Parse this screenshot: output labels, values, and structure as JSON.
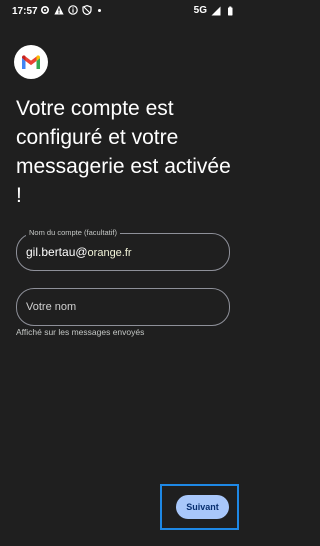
{
  "status_bar": {
    "time": "17:57",
    "left_icons": [
      "gear-icon",
      "warning-icon",
      "info-icon",
      "shield-icon"
    ],
    "network": "5G",
    "right_icons": [
      "signal-icon",
      "battery-icon"
    ]
  },
  "app": {
    "logo": "gmail-logo"
  },
  "headline": "Votre compte est configuré et votre messagerie est activée !",
  "account_field": {
    "label": "Nom du compte (facultatif)",
    "value_user": "gil.bertau@",
    "value_domain": "orange.fr"
  },
  "name_field": {
    "placeholder": "Votre nom",
    "helper": "Affiché sur les messages envoyés"
  },
  "next_button": {
    "label": "Suivant"
  },
  "colors": {
    "background": "#1f1f1f",
    "button_bg": "#a8c7fa",
    "button_text": "#062e6f",
    "highlight": "#1e88e5"
  }
}
